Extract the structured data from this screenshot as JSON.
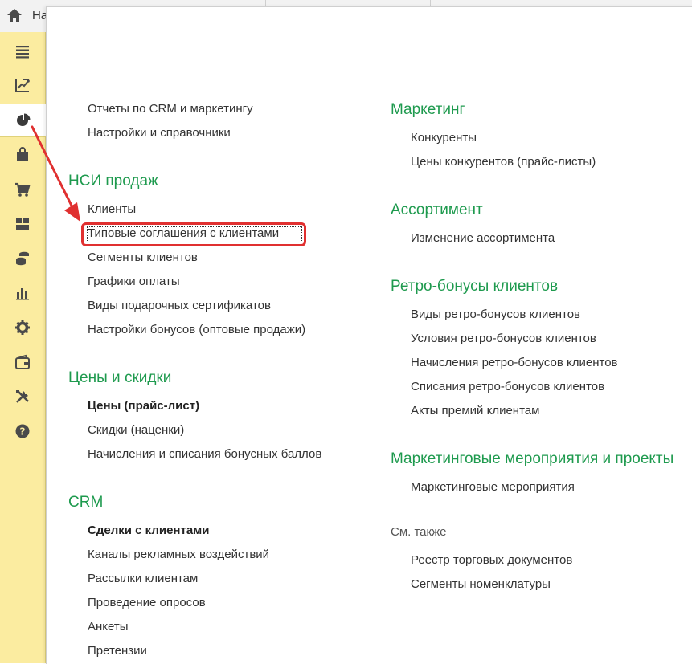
{
  "topbar": {
    "home_label": "На"
  },
  "sidebar": {
    "items": [
      {
        "icon": "menu-icon"
      },
      {
        "icon": "chart-crm-icon"
      },
      {
        "icon": "pie-chart-icon",
        "active": true
      },
      {
        "icon": "shopping-bag-icon"
      },
      {
        "icon": "cart-icon"
      },
      {
        "icon": "warehouse-icon"
      },
      {
        "icon": "coins-icon"
      },
      {
        "icon": "bar-chart-icon"
      },
      {
        "icon": "gear-icon"
      },
      {
        "icon": "wallet-icon"
      },
      {
        "icon": "tools-icon"
      },
      {
        "icon": "help-icon"
      }
    ]
  },
  "left": {
    "top_links": [
      "Отчеты по CRM и маркетингу",
      "Настройки и справочники"
    ],
    "nsi": {
      "title": "НСИ продаж",
      "links": [
        "Клиенты",
        "Типовые соглашения с клиентами",
        "Сегменты клиентов",
        "Графики оплаты",
        "Виды подарочных сертификатов",
        "Настройки бонусов (оптовые продажи)"
      ]
    },
    "prices": {
      "title": "Цены и скидки",
      "links": [
        "Цены (прайс-лист)",
        "Скидки (наценки)",
        "Начисления и списания бонусных баллов"
      ]
    },
    "crm": {
      "title": "CRM",
      "links": [
        "Сделки с клиентами",
        "Каналы рекламных воздействий",
        "Рассылки клиентам",
        "Проведение опросов",
        "Анкеты",
        "Претензии"
      ]
    }
  },
  "right": {
    "marketing": {
      "title": "Маркетинг",
      "links": [
        "Конкуренты",
        "Цены конкурентов (прайс-листы)"
      ]
    },
    "assortment": {
      "title": "Ассортимент",
      "links": [
        "Изменение ассортимента"
      ]
    },
    "retro": {
      "title": "Ретро-бонусы клиентов",
      "links": [
        "Виды ретро-бонусов клиентов",
        "Условия ретро-бонусов клиентов",
        "Начисления ретро-бонусов клиентов",
        "Списания ретро-бонусов клиентов",
        "Акты премий клиентам"
      ]
    },
    "events": {
      "title": "Маркетинговые мероприятия и проекты",
      "links": [
        "Маркетинговые мероприятия"
      ]
    },
    "see_also": {
      "title": "См. также",
      "links": [
        "Реестр торговых документов",
        "Сегменты номенклатуры"
      ]
    }
  },
  "colors": {
    "heading": "#1e9a4e",
    "sidebar_bg": "#fbeca0",
    "highlight": "#e03030"
  }
}
